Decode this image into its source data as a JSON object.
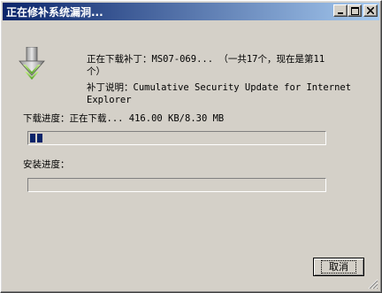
{
  "window": {
    "title": "正在修补系统漏洞..."
  },
  "titlebar_buttons": {
    "minimize": "minimize-icon",
    "maximize": "maximize-icon",
    "close": "close-icon"
  },
  "download": {
    "patch_line": "正在下载补丁：MS07-069... （一共17个，现在是第11",
    "patch_line_cont": "个）",
    "desc_line": "补丁说明：Cumulative Security Update for Internet",
    "desc_line_cont": "Explorer",
    "progress_text": "下载进度：正在下载... 416.00 KB/8.30 MB",
    "progress_fraction": 0.049
  },
  "install": {
    "label": "安装进度：",
    "progress_fraction": 0
  },
  "buttons": {
    "cancel": "取消"
  },
  "icons": {
    "download": "download-arrow-icon"
  },
  "colors": {
    "titlebar_start": "#0a246a",
    "titlebar_end": "#a6caf0",
    "progress_fill": "#0a246a",
    "window_bg": "#d4d0c8"
  }
}
